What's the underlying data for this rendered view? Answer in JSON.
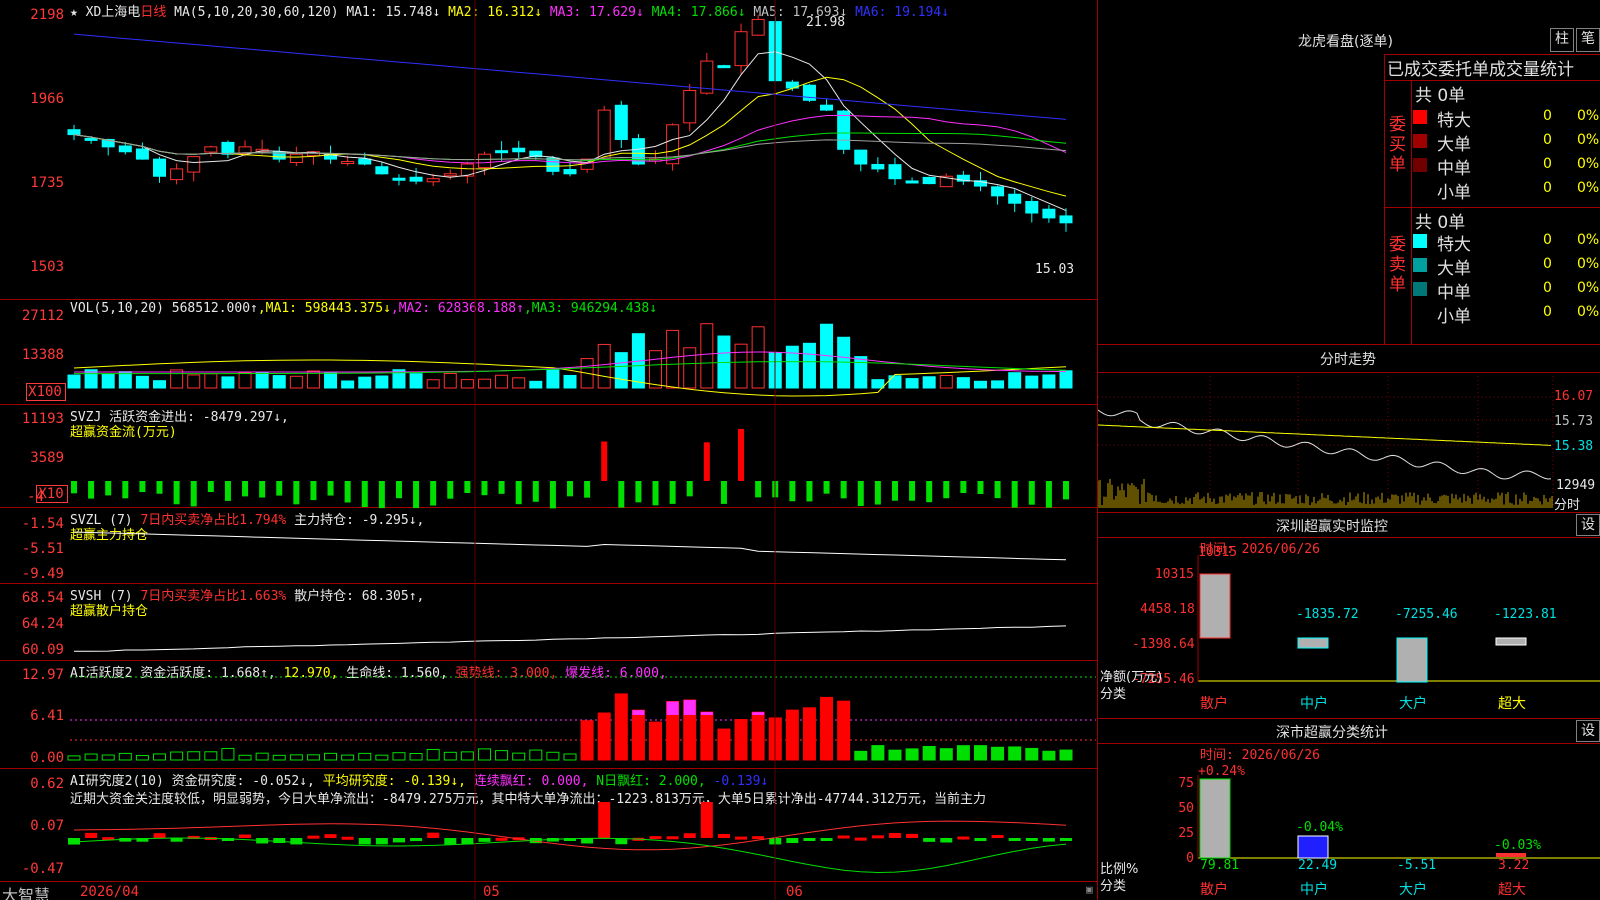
{
  "main": {
    "title_star": "★",
    "stock_name": "XD上海电",
    "period": "日线",
    "ma_label": "MA(5,10,20,30,60,120)",
    "ma": [
      {
        "label": "MA1: 15.748↓",
        "color": "#e8e8e8"
      },
      {
        "label": "MA2: 16.312↓",
        "color": "#ffff00"
      },
      {
        "label": "MA3: 17.629↓",
        "color": "#ff30ff"
      },
      {
        "label": "MA4: 17.866↓",
        "color": "#00e000"
      },
      {
        "label": "MA5: 17.693↓",
        "color": "#c0c0c0"
      },
      {
        "label": "MA6: 19.194↓",
        "color": "#3030ff"
      }
    ],
    "y_ticks": [
      "2198",
      "1966",
      "1735",
      "1503"
    ],
    "high_label": "21.98",
    "low_label": "15.03"
  },
  "volume": {
    "header": "VOL(5,10,20)",
    "value": "568512.000↑",
    "ma1": ",MA1: 598443.375↓",
    "ma2": ",MA2: 628368.188↑",
    "ma3": ",MA3: 946294.438↓",
    "y_ticks": [
      "27112",
      "13388"
    ],
    "unit": "X100"
  },
  "svzj": {
    "header": "SVZJ  活跃资金进出: -8479.297↓,",
    "subtitle": "超赢资金流(万元)",
    "y_ticks": [
      "11193",
      "3589",
      "-4"
    ],
    "unit": "X10"
  },
  "svzl": {
    "header_a": "SVZL (7)",
    "header_b": " 7日内买卖净占比1.794%",
    "header_c": " 主力持仓: -9.295↓,",
    "subtitle": "超赢主力持仓",
    "y_ticks": [
      "-1.54",
      "-5.51",
      "-9.49"
    ]
  },
  "svsh": {
    "header_a": "SVSH (7)",
    "header_b": " 7日内买卖净占比1.663%",
    "header_c": " 散户持仓: 68.305↑,",
    "subtitle": "超赢散户持仓",
    "y_ticks": [
      "68.54",
      "64.24",
      "60.09"
    ]
  },
  "ai_active": {
    "header_a": "AI活跃度2 资金活跃度: 1.668↑,",
    "header_b": " 12.970,",
    "header_c": " 生命线: 1.560,",
    "header_d": " 强势线: 3.000,",
    "header_e": " 爆发线: 6.000,",
    "y_ticks": [
      "12.97",
      "6.41",
      "0.00"
    ]
  },
  "ai_research": {
    "header_a": "AI研究度2(10) 资金研究度: -0.052↓,",
    "header_b": " 平均研究度: -0.139↓,",
    "header_c": " 连续飘红: 0.000,",
    "header_d": " N日飘红: 2.000,",
    "header_e": " -0.139↓",
    "comment": "近期大资金关注度较低，明显弱势，今日大单净流出：-8479.275万元，其中特大单净流出：-1223.813万元，大单5日累计净出-47744.312万元，当前主力",
    "y_ticks": [
      "0.62",
      "0.07",
      "-0.47"
    ]
  },
  "footer": {
    "brand": "大智慧",
    "dates": [
      "2026/04",
      "05",
      "06"
    ]
  },
  "longhu": {
    "title": "龙虎看盘(逐单)",
    "btn_bar": "柱",
    "btn_pen": "笔",
    "subtitle": "已成交委托单成交量统计",
    "buy_label": "委买单",
    "sell_label": "委卖单",
    "buy_total": "共 0单",
    "sell_total": "共 0单",
    "buy_rows": [
      {
        "name": "特大",
        "count": "0",
        "pct": "0%",
        "color": "#ff0000"
      },
      {
        "name": "大单",
        "count": "0",
        "pct": "0%",
        "color": "#a00000"
      },
      {
        "name": "中单",
        "count": "0",
        "pct": "0%",
        "color": "#700000"
      },
      {
        "name": "小单",
        "count": "0",
        "pct": "0%",
        "color": "#000000"
      }
    ],
    "sell_rows": [
      {
        "name": "特大",
        "count": "0",
        "pct": "0%",
        "color": "#00ffff"
      },
      {
        "name": "大单",
        "count": "0",
        "pct": "0%",
        "color": "#00a0a0"
      },
      {
        "name": "中单",
        "count": "0",
        "pct": "0%",
        "color": "#007878"
      },
      {
        "name": "小单",
        "count": "0",
        "pct": "0%",
        "color": "#000000"
      }
    ]
  },
  "intraday": {
    "title": "分时走势",
    "y_ticks": [
      "16.07",
      "15.73",
      "15.38"
    ],
    "vol_tick": "12949",
    "unit_label": "分时"
  },
  "sz_monitor": {
    "title": "深圳超赢实时监控",
    "settings": "设",
    "time": "时间: 2026/06/26",
    "y_ticks": [
      "10315",
      "4458.18",
      "-1398.64",
      "-7255.46"
    ],
    "bars": [
      {
        "cat": "散户",
        "value": "10315"
      },
      {
        "cat": "中户",
        "value": "-1835.72"
      },
      {
        "cat": "大户",
        "value": "-7255.46"
      },
      {
        "cat": "超大",
        "value": "-1223.81"
      }
    ],
    "axis_label": "净额(万元)",
    "axis_label2": "分类"
  },
  "sz_class": {
    "title": "深市超赢分类统计",
    "settings": "设",
    "time": "时间: 2026/06/26",
    "y_ticks": [
      "75",
      "50",
      "25",
      "0"
    ],
    "pct_labels": [
      "+0.24%",
      "-0.04%",
      "-0.03%"
    ],
    "bars": [
      {
        "cat": "散户",
        "value": "79.81"
      },
      {
        "cat": "中户",
        "value": "22.49"
      },
      {
        "cat": "大户",
        "value": "-5.51"
      },
      {
        "cat": "超大",
        "value": "3.22"
      }
    ],
    "axis_label": "比例%",
    "axis_label2": "分类"
  }
}
